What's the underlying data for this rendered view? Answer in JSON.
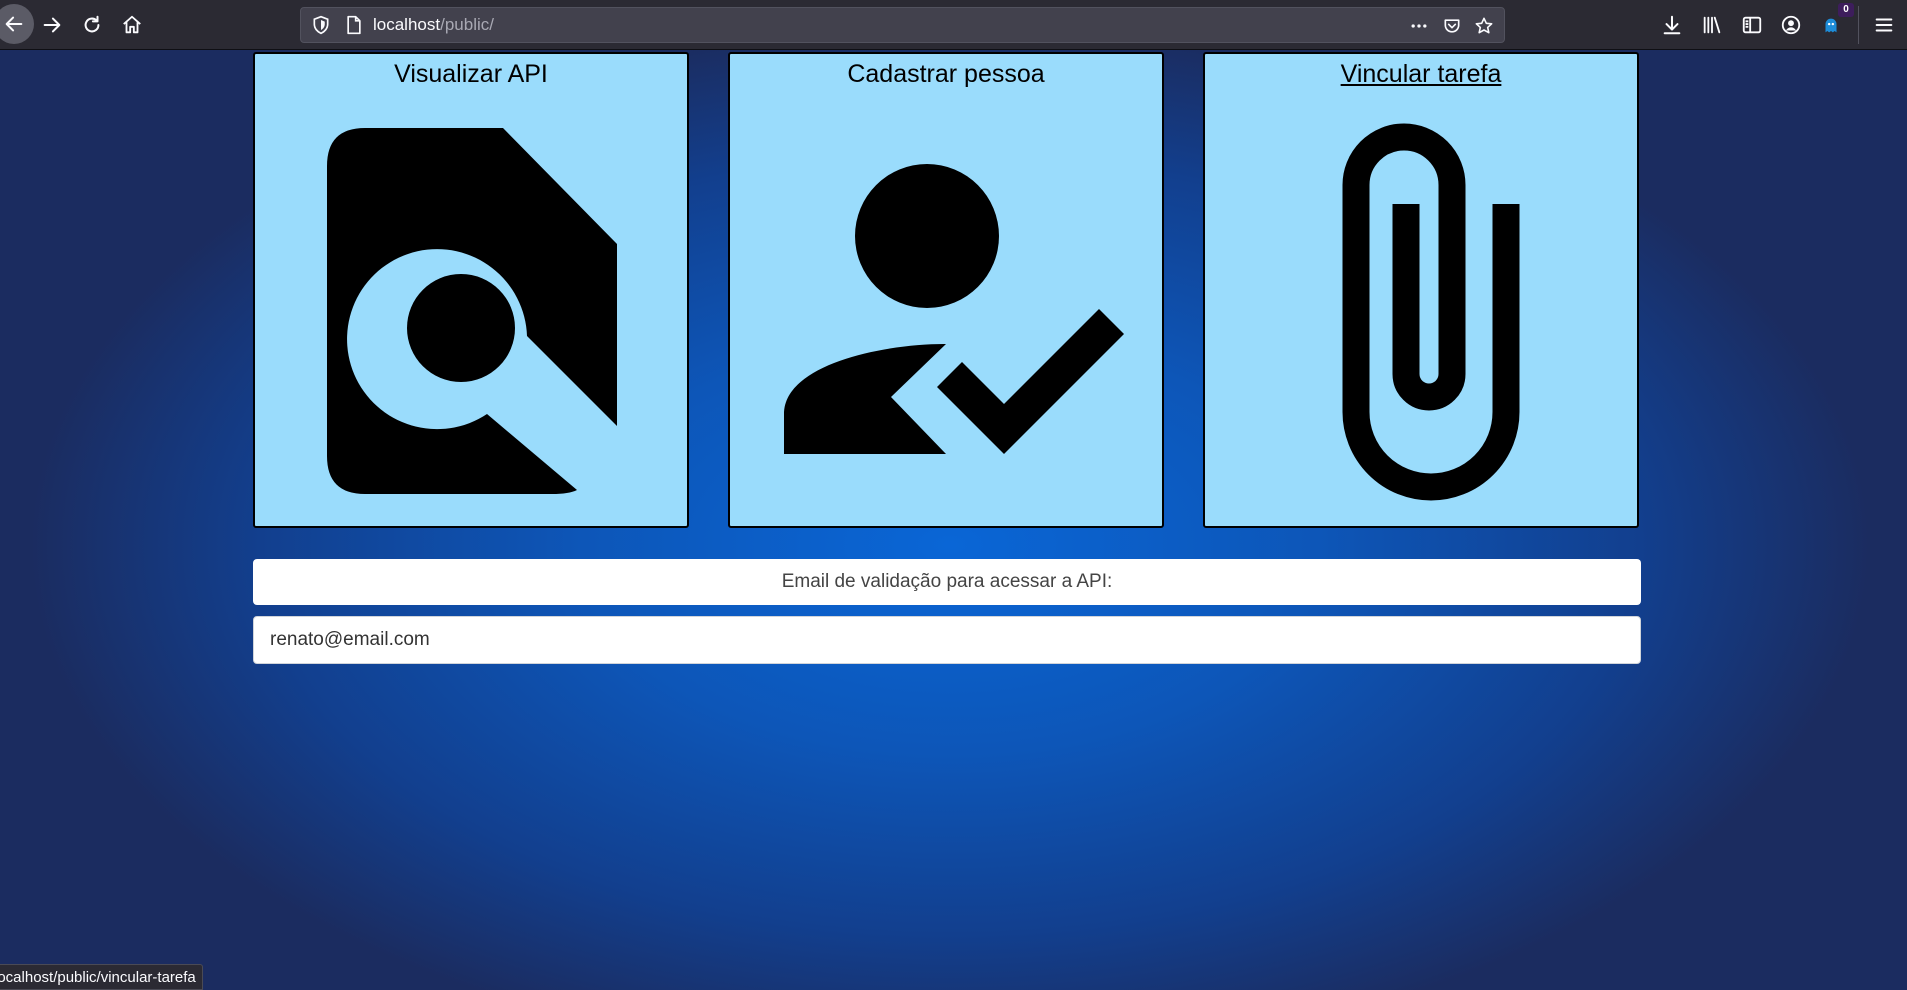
{
  "browser": {
    "url_host": "localhost",
    "url_path": "/public/",
    "notification_count": "0",
    "icons": {
      "back": "arrow-left-icon",
      "forward": "arrow-right-icon",
      "reload": "reload-icon",
      "home": "home-icon",
      "tracking": "shield-icon",
      "page": "page-icon",
      "more": "more-icon",
      "pocket": "pocket-icon",
      "bookmark": "star-icon",
      "downloads": "download-icon",
      "library": "library-icon",
      "sidebar": "sidebar-icon",
      "account": "account-icon",
      "extension": "extension-icon",
      "menu": "hamburger-menu-icon"
    }
  },
  "cards": [
    {
      "title": "Visualizar API",
      "icon": "find-in-page-icon"
    },
    {
      "title": "Cadastrar pessoa",
      "icon": "person-check-icon"
    },
    {
      "title": "Vincular tarefa",
      "icon": "paperclip-icon"
    }
  ],
  "email": {
    "label": "Email de validação para acessar a API:",
    "value": "renato@email.com"
  },
  "status_bar": {
    "link_text": "localhost/public/vincular-tarefa"
  },
  "colors": {
    "card_background": "#9adcfc",
    "page_gradient_center": "#0a66d6",
    "page_gradient_edge": "#1b2c60",
    "toolbar_background": "#2b2a33"
  }
}
